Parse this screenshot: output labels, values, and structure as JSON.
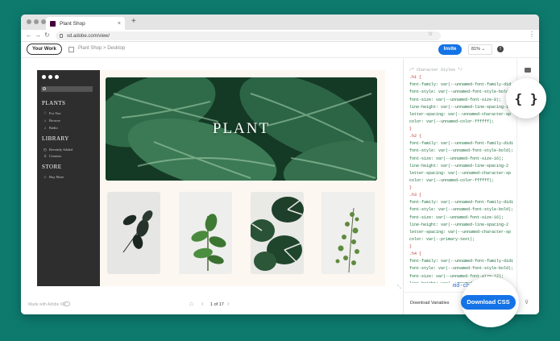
{
  "browser": {
    "tab_title": "Plant Shop",
    "tab_close": "×",
    "new_tab": "+",
    "back": "←",
    "forward": "→",
    "reload": "↻",
    "url": "xd.adobe.com/view/",
    "star": "☆",
    "menu": "⋮"
  },
  "header": {
    "your_work": "Your Work",
    "breadcrumb": "Plant Shop  >  Desktop",
    "invite": "Invite",
    "zoom": "81%   ⌄",
    "help": "!"
  },
  "artboard": {
    "hero_title": "PLANT",
    "sidebar": {
      "sections": [
        {
          "title": "PLANTS",
          "items": [
            {
              "icon": "♡",
              "label": "For You"
            },
            {
              "icon": "⌂",
              "label": "Browse"
            },
            {
              "icon": "♪",
              "label": "Radio"
            }
          ]
        },
        {
          "title": "LIBRARY",
          "items": [
            {
              "icon": "◴",
              "label": "Recently Added"
            },
            {
              "icon": "♙",
              "label": "Creators"
            }
          ]
        },
        {
          "title": "STORE",
          "items": [
            {
              "icon": "☆",
              "label": "Buy More"
            }
          ]
        }
      ]
    }
  },
  "canvas_footer": {
    "made_with": "Made with Adobe XD",
    "home": "⌂",
    "prev": "‹",
    "pager": "1 of 17",
    "next": "›"
  },
  "panel": {
    "code_lines": [
      {
        "cls": "c-com",
        "text": "/* Character Styles */"
      },
      {
        "cls": "c-sel",
        "text": ".h1 {"
      },
      {
        "cls": "c-prop",
        "text": "font-family: var(--unnamed-font-family-did"
      },
      {
        "cls": "c-prop",
        "text": "font-style: var(--unnamed-font-style-bold)"
      },
      {
        "cls": "c-prop",
        "text": "font-size: var(--unnamed-font-size-8);"
      },
      {
        "cls": "c-prop",
        "text": "line-height: var(--unnamed-line-spacing-1"
      },
      {
        "cls": "c-prop",
        "text": "letter-spacing: var(--unnamed-character-sp"
      },
      {
        "cls": "c-prop",
        "text": "color: var(--unnamed-color-ffffff);"
      },
      {
        "cls": "c-sel",
        "text": "}"
      },
      {
        "cls": "c-sel",
        "text": ".h2 {"
      },
      {
        "cls": "c-prop",
        "text": "font-family: var(--unnamed-font-family-didi"
      },
      {
        "cls": "c-prop",
        "text": "font-style: var(--unnamed-font-style-bold);"
      },
      {
        "cls": "c-prop",
        "text": "font-size: var(--unnamed-font-size-16);"
      },
      {
        "cls": "c-prop",
        "text": "line-height: var(--unnamed-line-spacing-2"
      },
      {
        "cls": "c-prop",
        "text": "letter-spacing: var(--unnamed-character-sp"
      },
      {
        "cls": "c-prop",
        "text": "color: var(--unnamed-color-ffffff);"
      },
      {
        "cls": "c-sel",
        "text": "}"
      },
      {
        "cls": "c-sel",
        "text": ".h3 {"
      },
      {
        "cls": "c-prop",
        "text": "font-family: var(--unnamed-font-family-didi"
      },
      {
        "cls": "c-prop",
        "text": "font-style: var(--unnamed-font-style-bold);"
      },
      {
        "cls": "c-prop",
        "text": "font-size: var(--unnamed-font-size-16);"
      },
      {
        "cls": "c-prop",
        "text": "line-height: var(--unnamed-line-spacing-2"
      },
      {
        "cls": "c-prop",
        "text": "letter-spacing: var(--unnamed-character-sp"
      },
      {
        "cls": "c-prop",
        "text": "color: var(--primary-text);"
      },
      {
        "cls": "c-sel",
        "text": "}"
      },
      {
        "cls": "c-sel",
        "text": ".h4 {"
      },
      {
        "cls": "c-prop",
        "text": "font-family: var(--unnamed-font-family-didi"
      },
      {
        "cls": "c-prop",
        "text": "font-style: var(--unnamed-font-style-bold);"
      },
      {
        "cls": "c-prop",
        "text": "font-size: var(--unnamed-font-size-12);"
      },
      {
        "cls": "c-prop",
        "text": "line-height: var(--unnamed-line-spacing-1"
      }
    ],
    "peek_text": "md-character-sp",
    "download_variables": "Download Variables",
    "download_css": "Download CSS",
    "code_button": "{ }",
    "filter": "⊽"
  },
  "colors": {
    "background": "#0e7a6e",
    "accent": "#1473e6",
    "sidebar": "#2e2e2e"
  }
}
